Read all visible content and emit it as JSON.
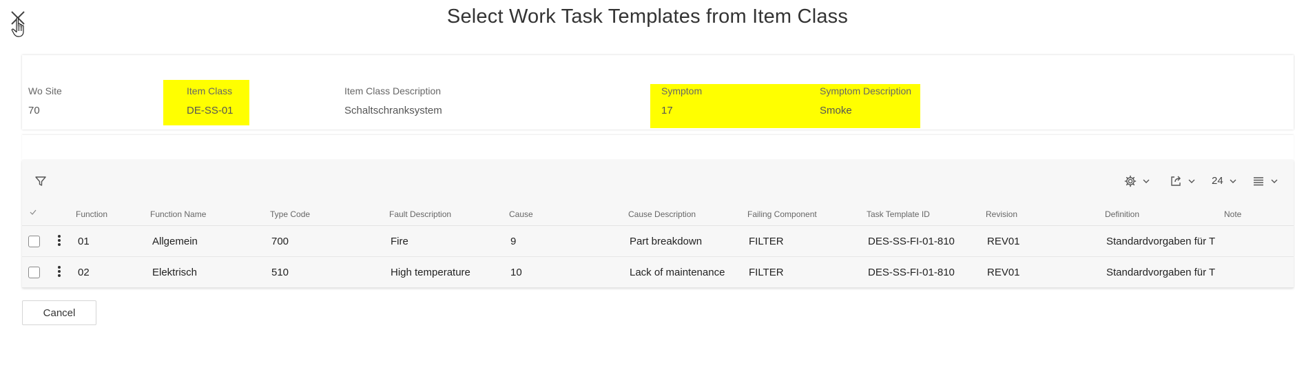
{
  "dialog": {
    "title": "Select Work Task Templates from Item Class"
  },
  "header": {
    "fields": [
      {
        "label": "Wo Site",
        "value": "70"
      },
      {
        "label": "Item Class",
        "value": "DE-SS-01"
      },
      {
        "label": "Item Class Description",
        "value": "Schaltschranksystem"
      },
      {
        "label": "Symptom",
        "value": "17"
      },
      {
        "label": "Symptom Description",
        "value": "Smoke"
      }
    ],
    "highlight_color": "#ffff00"
  },
  "toolbar": {
    "page_size": "24",
    "icons": [
      "filter-icon",
      "gear-icon",
      "export-icon",
      "column-chooser-icon"
    ]
  },
  "table": {
    "columns": [
      "Function",
      "Function Name",
      "Type Code",
      "Fault Description",
      "Cause",
      "Cause Description",
      "Failing Component",
      "Task Template ID",
      "Revision",
      "Definition",
      "Note"
    ],
    "rows": [
      {
        "function": "01",
        "function_name": "Allgemein",
        "type_code": "700",
        "fault_description": "Fire",
        "cause": "9",
        "cause_description": "Part breakdown",
        "failing_component": "FILTER",
        "task_template_id": "DES-SS-FI-01-810",
        "revision": "REV01",
        "definition": "Standardvorgaben für Tä",
        "note": ""
      },
      {
        "function": "02",
        "function_name": "Elektrisch",
        "type_code": "510",
        "fault_description": "High temperature",
        "cause": "10",
        "cause_description": "Lack of maintenance",
        "failing_component": "FILTER",
        "task_template_id": "DES-SS-FI-01-810",
        "revision": "REV01",
        "definition": "Standardvorgaben für Tä",
        "note": ""
      }
    ]
  },
  "footer": {
    "cancel_label": "Cancel"
  }
}
